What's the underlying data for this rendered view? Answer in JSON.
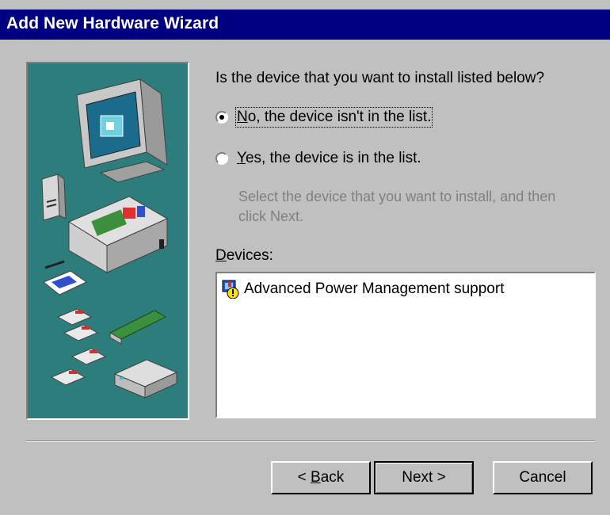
{
  "window": {
    "title": "Add New Hardware Wizard"
  },
  "question": "Is the device that you want to install listed below?",
  "options": [
    {
      "mnemonic": "N",
      "rest": "o, the device isn't in the list.",
      "selected": true
    },
    {
      "mnemonic": "Y",
      "rest": "es, the device is in the list.",
      "selected": false
    }
  ],
  "hint": "Select the device that you want to install, and then click Next.",
  "devices": {
    "label_mnemonic": "D",
    "label_rest": "evices:",
    "items": [
      {
        "label": "Advanced Power Management support"
      }
    ]
  },
  "buttons": {
    "back_prefix": "< ",
    "back_mnemonic": "B",
    "back_rest": "ack",
    "next": "Next >",
    "cancel": "Cancel"
  },
  "colors": {
    "titlebar": "#000080",
    "art_bg": "#2e7d7d",
    "face": "#c0c0c0"
  },
  "icons": [
    "computer-hardware-illustration",
    "device-warning-icon"
  ]
}
